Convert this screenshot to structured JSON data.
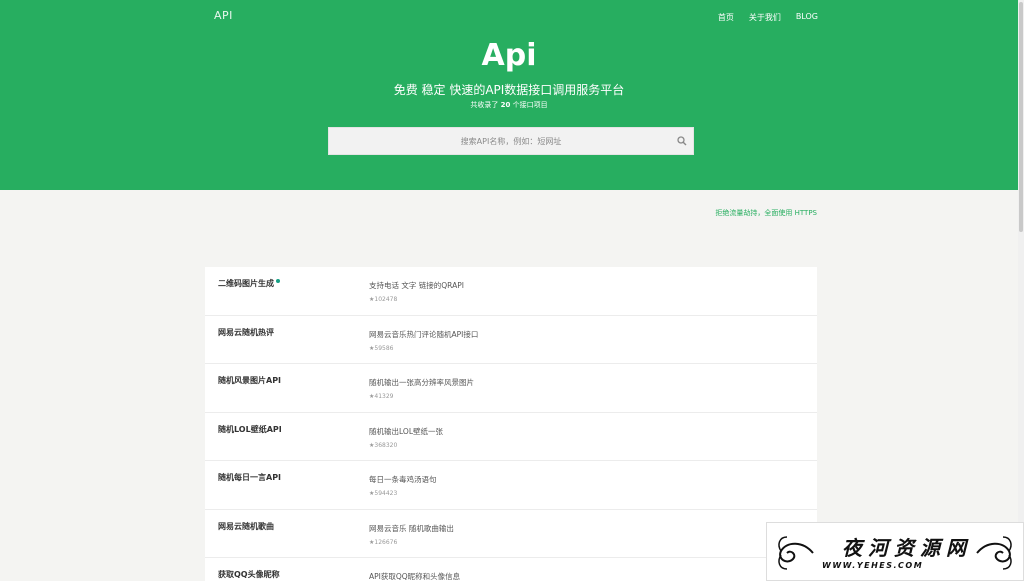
{
  "header": {
    "brand": "API",
    "nav": [
      {
        "label": "首页"
      },
      {
        "label": "关于我们"
      },
      {
        "label": "BLOG"
      }
    ],
    "title": "Api",
    "subtitle": "免费 稳定 快速的API数据接口调用服务平台",
    "count_prefix": "共收录了",
    "count_value": "20",
    "count_suffix": "个接口项目"
  },
  "search": {
    "placeholder": "搜索API名称，例如：短网址",
    "icon": "search-icon"
  },
  "https_note": "拒绝流量劫持，全面使用 HTTPS",
  "apis": [
    {
      "name": "二维码图片生成",
      "new_dot": true,
      "desc": "支持电话 文字 链接的QRAPI",
      "stars": "★102478"
    },
    {
      "name": "网易云随机热评",
      "new_dot": false,
      "desc": "网易云音乐热门评论随机API接口",
      "stars": "★59586"
    },
    {
      "name": "随机风景图片API",
      "new_dot": false,
      "desc": "随机输出一张高分辨率风景图片",
      "stars": "★41329"
    },
    {
      "name": "随机LOL壁纸API",
      "new_dot": false,
      "desc": "随机输出LOL壁纸一张",
      "stars": "★368320"
    },
    {
      "name": "随机每日一言API",
      "new_dot": false,
      "desc": "每日一条毒鸡汤语句",
      "stars": "★594423"
    },
    {
      "name": "网易云随机歌曲",
      "new_dot": false,
      "desc": "网易云音乐 随机歌曲输出",
      "stars": "★126676"
    },
    {
      "name": "获取QQ头像昵称",
      "new_dot": false,
      "desc": "API获取QQ昵称和头像信息",
      "stars": ""
    }
  ],
  "watermark": {
    "text": "夜河资源网",
    "url": "WWW.YEHES.COM"
  },
  "colors": {
    "brand_green": "#27ae60",
    "dot_teal": "#16a085"
  }
}
